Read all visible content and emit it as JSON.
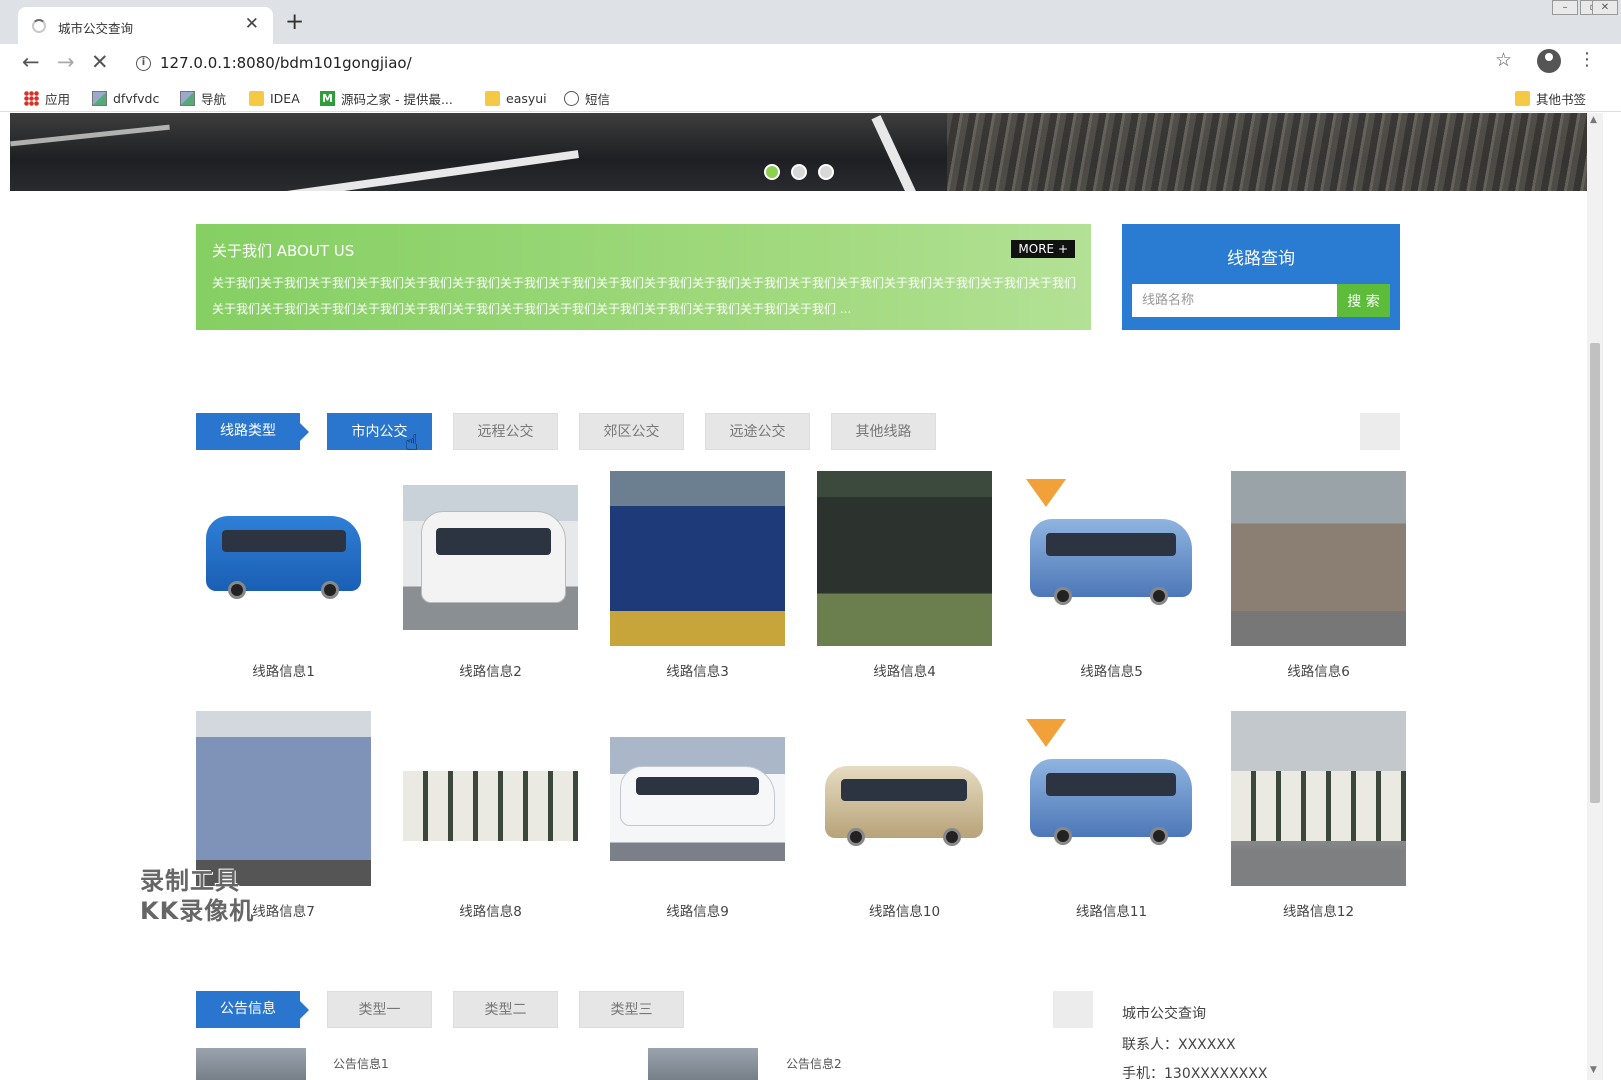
{
  "browser": {
    "tab_title": "城市公交查询",
    "tab_close": "✕",
    "new_tab": "+",
    "url": "127.0.0.1:8080/bdm101gongjiao/",
    "bookmarks": [
      "应用",
      "dfvfvdc",
      "导航",
      "IDEA",
      "源码之家 - 提供最...",
      "easyui",
      "短信"
    ],
    "other_bookmarks": "其他书签"
  },
  "banner": {
    "dots": 3,
    "active_dot": 0
  },
  "about": {
    "title": "关于我们 ABOUT US",
    "more_label": "MORE +",
    "text": "关于我们关于我们关于我们关于我们关于我们关于我们关于我们关于我们关于我们关于我们关于我们关于我们关于我们关于我们关于我们关于我们关于我们关于我们关于我们关于我们关于我们关于我们关于我们关于我们关于我们关于我们关于我们关于我们关于我们关于我们关于我们 ..."
  },
  "search": {
    "title": "线路查询",
    "placeholder": "线路名称",
    "button_label": "搜 索"
  },
  "routes_section": {
    "category_label": "线路类型",
    "tabs": [
      "市内公交",
      "远程公交",
      "郊区公交",
      "远途公交",
      "其他线路"
    ],
    "active_tab": 0,
    "items": [
      "线路信息1",
      "线路信息2",
      "线路信息3",
      "线路信息4",
      "线路信息5",
      "线路信息6",
      "线路信息7",
      "线路信息8",
      "线路信息9",
      "线路信息10",
      "线路信息11",
      "线路信息12"
    ]
  },
  "watermark": {
    "line1": "录制工具",
    "line2": "KK录像机"
  },
  "notice_section": {
    "category_label": "公告信息",
    "tabs": [
      "类型一",
      "类型二",
      "类型三"
    ],
    "items": [
      "公告信息1",
      "公告信息2"
    ]
  },
  "contact": {
    "title": "城市公交查询",
    "person": "联系人：XXXXXX",
    "phone": "手机：130XXXXXXXX"
  },
  "colors": {
    "primary_blue": "#2a76cf",
    "about_green": "#8fd46c",
    "search_green": "#5dbd3a"
  }
}
